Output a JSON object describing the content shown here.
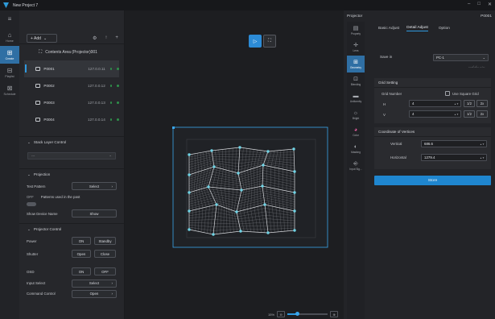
{
  "window": {
    "title": "New Project 7",
    "controls": [
      "–",
      "□",
      "✕"
    ]
  },
  "rail": [
    {
      "icon": "≡",
      "label": ""
    },
    {
      "icon": "⌂",
      "label": "Home"
    },
    {
      "icon": "⊞",
      "label": "Create"
    },
    {
      "icon": "⊟",
      "label": "Playlist"
    },
    {
      "icon": "⊠",
      "label": "Schedule"
    }
  ],
  "left": {
    "add_label": "+ Add",
    "tools": [
      "⚙",
      "↑",
      "+"
    ],
    "contents_area": "Contents Area (Projector)001",
    "projectors": [
      {
        "name": "P0001",
        "ip": "127.0.0.11"
      },
      {
        "name": "P0002",
        "ip": "127.0.0.12"
      },
      {
        "name": "P0003",
        "ip": "127.0.0.13"
      },
      {
        "name": "P0004",
        "ip": "127.0.0.14"
      }
    ],
    "stack_layer": "Stack Layer Control",
    "stack_select": "---",
    "projection": "Projection",
    "test_pattern": "Test Pattern",
    "select": "Select",
    "off": "OFF",
    "patterns_used": "Patterns used in the past",
    "show_device": "Show Device Name",
    "show": "Show",
    "projector_control": "Projector Control",
    "power": "Power",
    "on": "ON",
    "standby": "Standby",
    "shutter": "Shutter",
    "open": "Open",
    "close": "Close",
    "osd": "OSD",
    "input_select": "Input Select",
    "command_control": "Command Control"
  },
  "canvas": {
    "zoom": "15%",
    "zoom_fraction": 0.25
  },
  "right": {
    "header": "Projector",
    "id": "P0001",
    "rail": [
      {
        "icon": "▤",
        "label": "Property"
      },
      {
        "icon": "✛",
        "label": "Lens"
      },
      {
        "icon": "⊞",
        "label": "Geometry"
      },
      {
        "icon": "⊡",
        "label": "Blending"
      },
      {
        "icon": "▬",
        "label": "Uniformity"
      },
      {
        "icon": "☼",
        "label": "Bright"
      },
      {
        "icon": "◕",
        "label": "Color"
      },
      {
        "icon": "◐",
        "label": "Masking"
      },
      {
        "icon": "⎆",
        "label": "Input Sig..."
      }
    ],
    "tabs": [
      "Basic Adjust",
      "Detail Adjust",
      "Option"
    ],
    "save_in": "Save in",
    "save_value": "PC-1",
    "save_date": "----/--/-- --:--",
    "grid_setting": "Grid Setting",
    "grid_number": "Grid Number",
    "use_square": "Use Square Grid",
    "h": "H",
    "v": "V",
    "h_value": "4",
    "v_value": "4",
    "half": "1/2",
    "double": "2x",
    "coord_title": "Coordinate of Vertices",
    "vertical": "Vertical",
    "vertical_value": "686.6",
    "horizontal": "Horizontal",
    "horizontal_value": "1279.4",
    "store": "Store"
  }
}
